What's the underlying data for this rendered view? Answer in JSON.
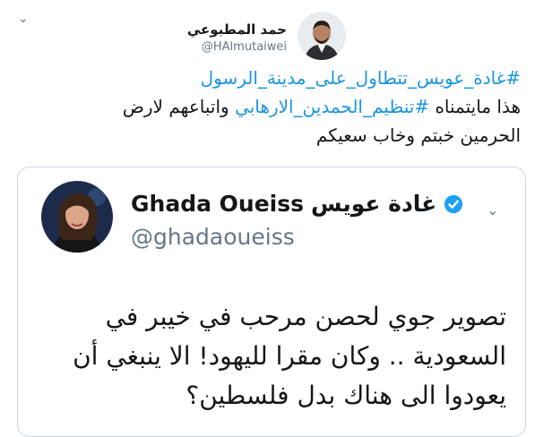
{
  "tweet": {
    "author_name": "حمد المطبوعي",
    "author_handle": "@HAlmutaiwei",
    "lines": [
      {
        "hashtag": "#غادة_عويس_تتطاول_على_مدينة_الرسول"
      },
      {
        "prefix": "هذا مايتمناه ",
        "hashtag": "#تنظيم_الحمدين_الارهابي",
        "suffix": " واتباعهم لارض"
      },
      {
        "text": "الحرمين خبتم وخاب سعيكم"
      }
    ]
  },
  "quoted_tweet": {
    "name_en": "Ghada Oueiss",
    "name_ar": "غادة عويس",
    "handle": "@ghadaoueiss",
    "verified": true,
    "lines": [
      "تصوير جوي لحصن مرحب في خيبر في",
      "السعودية .. وكان مقرا لليهود! الا ينبغي أن",
      "يعودوا الى هناك بدل فلسطين؟"
    ]
  },
  "icons": {
    "menu": "chevron-down-icon",
    "verified": "verified-badge-icon"
  },
  "colors": {
    "hashtag": "#1b95e0",
    "verified": "#1da1f2",
    "secondary_text": "#657786",
    "border": "#ccd6dd"
  }
}
